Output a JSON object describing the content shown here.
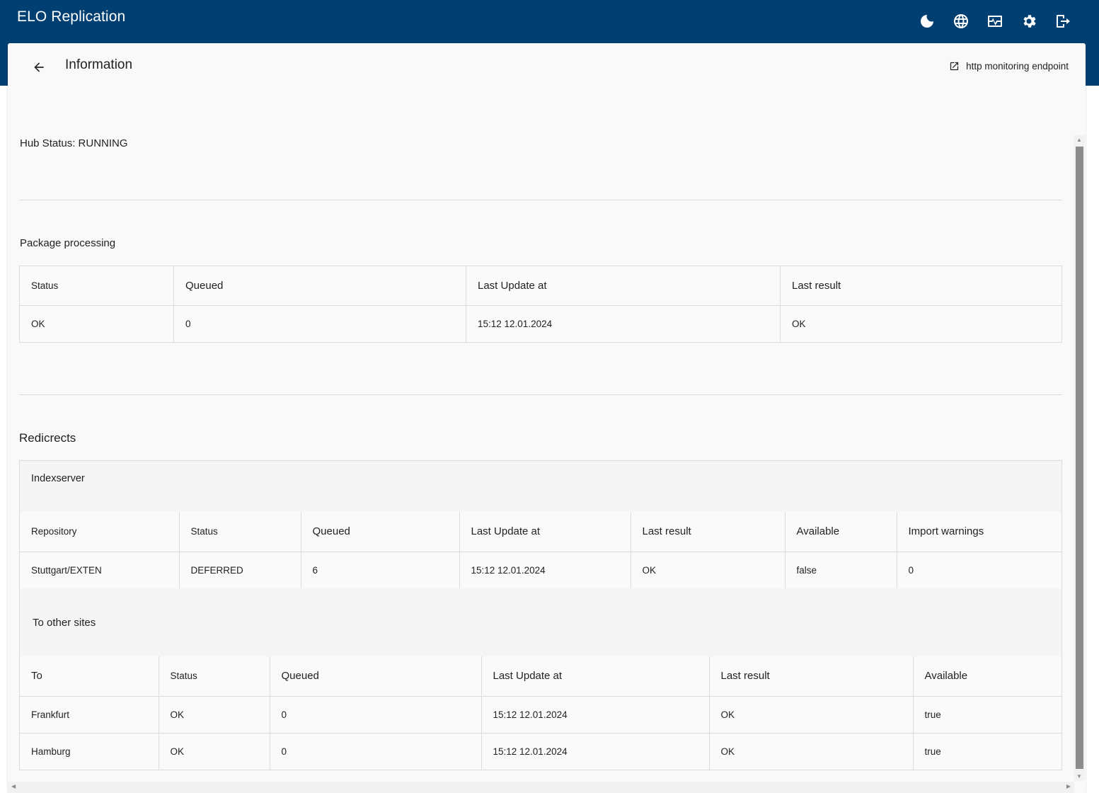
{
  "app": {
    "title": "ELO Replication"
  },
  "header_icons": [
    {
      "name": "dark-mode-icon"
    },
    {
      "name": "globe-icon"
    },
    {
      "name": "monitoring-icon"
    },
    {
      "name": "settings-gear-icon"
    },
    {
      "name": "logout-icon"
    }
  ],
  "page": {
    "title": "Information",
    "monitoring_link": "http monitoring endpoint",
    "hub_status": "Hub Status: RUNNING"
  },
  "package_processing": {
    "label": "Package processing",
    "headers": [
      "Status",
      "Queued",
      "Last Update at",
      "Last result"
    ],
    "rows": [
      [
        "OK",
        "0",
        "15:12 12.01.2024",
        "OK"
      ]
    ]
  },
  "redirects": {
    "label": "Redicrects",
    "indexserver": {
      "label": "Indexserver",
      "headers": [
        "Repository",
        "Status",
        "Queued",
        "Last Update at",
        "Last result",
        "Available",
        "Import warnings"
      ],
      "rows": [
        [
          "Stuttgart/EXTEN",
          "DEFERRED",
          "6",
          "15:12 12.01.2024",
          "OK",
          "false",
          "0"
        ]
      ]
    },
    "other_sites": {
      "label": "To other sites",
      "headers": [
        "To",
        "Status",
        "Queued",
        "Last Update at",
        "Last result",
        "Available"
      ],
      "rows": [
        [
          "Frankfurt",
          "OK",
          "0",
          "15:12 12.01.2024",
          "OK",
          "true"
        ],
        [
          "Hamburg",
          "OK",
          "0",
          "15:12 12.01.2024",
          "OK",
          "true"
        ]
      ]
    }
  }
}
